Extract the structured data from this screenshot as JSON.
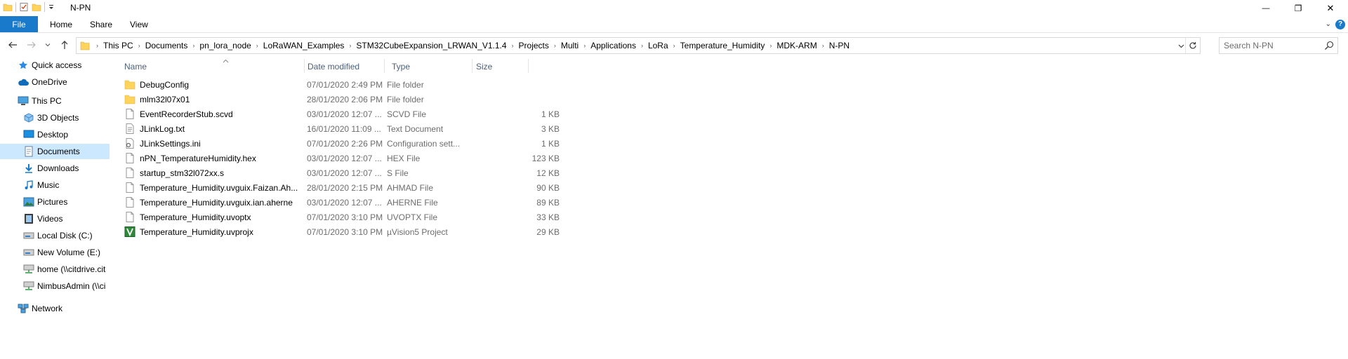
{
  "window": {
    "title": "N-PN",
    "controls": {
      "minimize": "—",
      "maximize": "❐",
      "close": "✕"
    }
  },
  "ribbon": {
    "tabs": [
      {
        "label": "File"
      },
      {
        "label": "Home"
      },
      {
        "label": "Share"
      },
      {
        "label": "View"
      }
    ],
    "help": "?"
  },
  "address": {
    "crumbs": [
      "This PC",
      "Documents",
      "pn_lora_node",
      "LoRaWAN_Examples",
      "STM32CubeExpansion_LRWAN_V1.1.4",
      "Projects",
      "Multi",
      "Applications",
      "LoRa",
      "Temperature_Humidity",
      "MDK-ARM",
      "N-PN"
    ]
  },
  "search": {
    "placeholder": "Search N-PN"
  },
  "navpane": {
    "items": [
      {
        "label": "Quick access",
        "icon": "star-icon"
      },
      {
        "label": "OneDrive",
        "icon": "cloud-icon"
      },
      {
        "label": "This PC",
        "icon": "computer-icon"
      },
      {
        "label": "3D Objects",
        "icon": "3d-objects-icon"
      },
      {
        "label": "Desktop",
        "icon": "desktop-icon"
      },
      {
        "label": "Documents",
        "icon": "documents-icon",
        "selected": true
      },
      {
        "label": "Downloads",
        "icon": "download-icon"
      },
      {
        "label": "Music",
        "icon": "music-icon"
      },
      {
        "label": "Pictures",
        "icon": "pictures-icon"
      },
      {
        "label": "Videos",
        "icon": "videos-icon"
      },
      {
        "label": "Local Disk (C:)",
        "icon": "disk-icon"
      },
      {
        "label": "New Volume (E:)",
        "icon": "disk-icon"
      },
      {
        "label": "home (\\\\citdrive.cit",
        "icon": "network-drive-icon"
      },
      {
        "label": "NimbusAdmin (\\\\ci",
        "icon": "network-drive-icon"
      },
      {
        "label": "Network",
        "icon": "network-icon"
      }
    ]
  },
  "columns": {
    "name": "Name",
    "date": "Date modified",
    "type": "Type",
    "size": "Size"
  },
  "files": [
    {
      "name": "DebugConfig",
      "date": "07/01/2020 2:49 PM",
      "type": "File folder",
      "size": "",
      "icon": "folder-icon"
    },
    {
      "name": "mlm32l07x01",
      "date": "28/01/2020 2:06 PM",
      "type": "File folder",
      "size": "",
      "icon": "folder-icon"
    },
    {
      "name": "EventRecorderStub.scvd",
      "date": "03/01/2020 12:07 ...",
      "type": "SCVD File",
      "size": "1 KB",
      "icon": "file-icon"
    },
    {
      "name": "JLinkLog.txt",
      "date": "16/01/2020 11:09 ...",
      "type": "Text Document",
      "size": "3 KB",
      "icon": "text-file-icon"
    },
    {
      "name": "JLinkSettings.ini",
      "date": "07/01/2020 2:26 PM",
      "type": "Configuration sett...",
      "size": "1 KB",
      "icon": "settings-file-icon"
    },
    {
      "name": "nPN_TemperatureHumidity.hex",
      "date": "03/01/2020 12:07 ...",
      "type": "HEX File",
      "size": "123 KB",
      "icon": "file-icon"
    },
    {
      "name": "startup_stm32l072xx.s",
      "date": "03/01/2020 12:07 ...",
      "type": "S File",
      "size": "12 KB",
      "icon": "file-icon"
    },
    {
      "name": "Temperature_Humidity.uvguix.Faizan.Ah...",
      "date": "28/01/2020 2:15 PM",
      "type": "AHMAD File",
      "size": "90 KB",
      "icon": "file-icon"
    },
    {
      "name": "Temperature_Humidity.uvguix.ian.aherne",
      "date": "03/01/2020 12:07 ...",
      "type": "AHERNE File",
      "size": "89 KB",
      "icon": "file-icon"
    },
    {
      "name": "Temperature_Humidity.uvoptx",
      "date": "07/01/2020 3:10 PM",
      "type": "UVOPTX File",
      "size": "33 KB",
      "icon": "file-icon"
    },
    {
      "name": "Temperature_Humidity.uvprojx",
      "date": "07/01/2020 3:10 PM",
      "type": "µVision5 Project",
      "size": "29 KB",
      "icon": "uvision-project-icon"
    }
  ],
  "colors": {
    "accent": "#1979ca",
    "selection": "#cce8ff",
    "folder": "#ffd35c",
    "header_text": "#4c607a"
  }
}
